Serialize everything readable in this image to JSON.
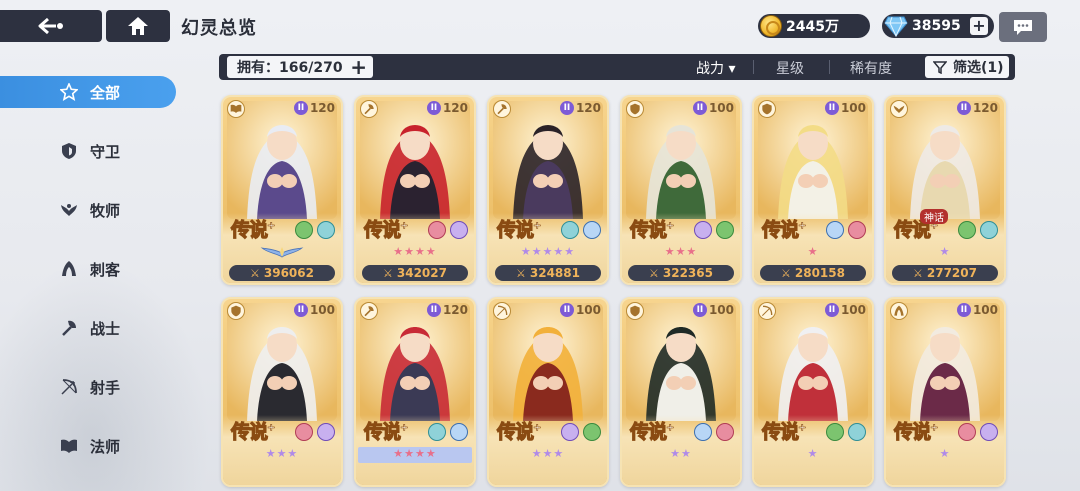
{
  "header": {
    "title": "幻灵总览",
    "gold": "2445万",
    "gems": "38595",
    "plus": "+"
  },
  "filter_bar": {
    "owned_label": "拥有：166/270",
    "owned_plus": "+",
    "sort_tabs": [
      "战力 ▾",
      "星级",
      "稀有度"
    ],
    "filter_label": "筛选(1)"
  },
  "sidebar": {
    "items": [
      {
        "label": "全部",
        "icon": "star-outline-icon"
      },
      {
        "label": "守卫",
        "icon": "shield-icon"
      },
      {
        "label": "牧师",
        "icon": "wings-icon"
      },
      {
        "label": "刺客",
        "icon": "assassin-icon"
      },
      {
        "label": "战士",
        "icon": "axe-icon"
      },
      {
        "label": "射手",
        "icon": "bow-icon"
      },
      {
        "label": "法师",
        "icon": "book-icon"
      }
    ]
  },
  "colors": {
    "accent": "#3b8fe0",
    "dark_bar": "#2d3140",
    "card_gold": "#f1c774",
    "power_text": "#f0b35a",
    "star_pink": "#e86f8a",
    "star_purple": "#b08ae8"
  },
  "cards": [
    {
      "level": "120",
      "rarity": "传说",
      "power": "396062",
      "role_icon": "book-icon",
      "hair": "#e9ecf3",
      "outfit": "#5b4a8c",
      "stars": "",
      "star_color": "",
      "stars_icon": "wings-crest-icon",
      "myth": ""
    },
    {
      "level": "120",
      "rarity": "传说",
      "power": "342027",
      "role_icon": "axe-icon",
      "hair": "#c8222c",
      "outfit": "#2b2230",
      "stars": "★★★★",
      "star_color": "#e86f8a",
      "myth": ""
    },
    {
      "level": "120",
      "rarity": "传说",
      "power": "324881",
      "role_icon": "axe-icon",
      "hair": "#2a2228",
      "outfit": "#4a3a5e",
      "stars": "★★★★★",
      "star_color": "#b08ae8",
      "myth": ""
    },
    {
      "level": "100",
      "rarity": "传说",
      "power": "322365",
      "role_icon": "shield-icon",
      "hair": "#e6e4d8",
      "outfit": "#3f6a3a",
      "stars": "★★★",
      "star_color": "#e86f8a",
      "myth": ""
    },
    {
      "level": "100",
      "rarity": "传说",
      "power": "280158",
      "role_icon": "shield-icon",
      "hair": "#f3dc86",
      "outfit": "#f3f1e6",
      "stars": "★",
      "star_color": "#e86f8a",
      "myth": ""
    },
    {
      "level": "120",
      "rarity": "传说",
      "power": "277207",
      "role_icon": "wings-icon",
      "hair": "#eeeae6",
      "outfit": "#e8d9b0",
      "stars": "★",
      "star_color": "#b08ae8",
      "myth": "神话"
    },
    {
      "level": "100",
      "rarity": "传说",
      "power": "",
      "role_icon": "shield-icon",
      "hair": "#eeeeee",
      "outfit": "#2a2a30",
      "stars": "★★★",
      "star_color": "#b08ae8",
      "myth": ""
    },
    {
      "level": "120",
      "rarity": "传说",
      "power": "",
      "role_icon": "axe-icon",
      "hair": "#c82a36",
      "outfit": "#3b3a55",
      "stars": "★★★★",
      "star_color": "#e86f8a",
      "myth": "",
      "selected": true
    },
    {
      "level": "100",
      "rarity": "传说",
      "power": "",
      "role_icon": "bow-icon",
      "hair": "#f2b03a",
      "outfit": "#8a2a1e",
      "stars": "★★★",
      "star_color": "#b08ae8",
      "myth": ""
    },
    {
      "level": "100",
      "rarity": "传说",
      "power": "",
      "role_icon": "shield-icon",
      "hair": "#1f2a26",
      "outfit": "#f0efe8",
      "stars": "★★",
      "star_color": "#b08ae8",
      "myth": ""
    },
    {
      "level": "100",
      "rarity": "传说",
      "power": "",
      "role_icon": "bow-icon",
      "hair": "#f0f0f2",
      "outfit": "#c0303a",
      "stars": "★",
      "star_color": "#b08ae8",
      "myth": ""
    },
    {
      "level": "100",
      "rarity": "传说",
      "power": "",
      "role_icon": "assassin-icon",
      "hair": "#f2ebe0",
      "outfit": "#6b2a48",
      "stars": "★",
      "star_color": "#b08ae8",
      "myth": ""
    }
  ]
}
